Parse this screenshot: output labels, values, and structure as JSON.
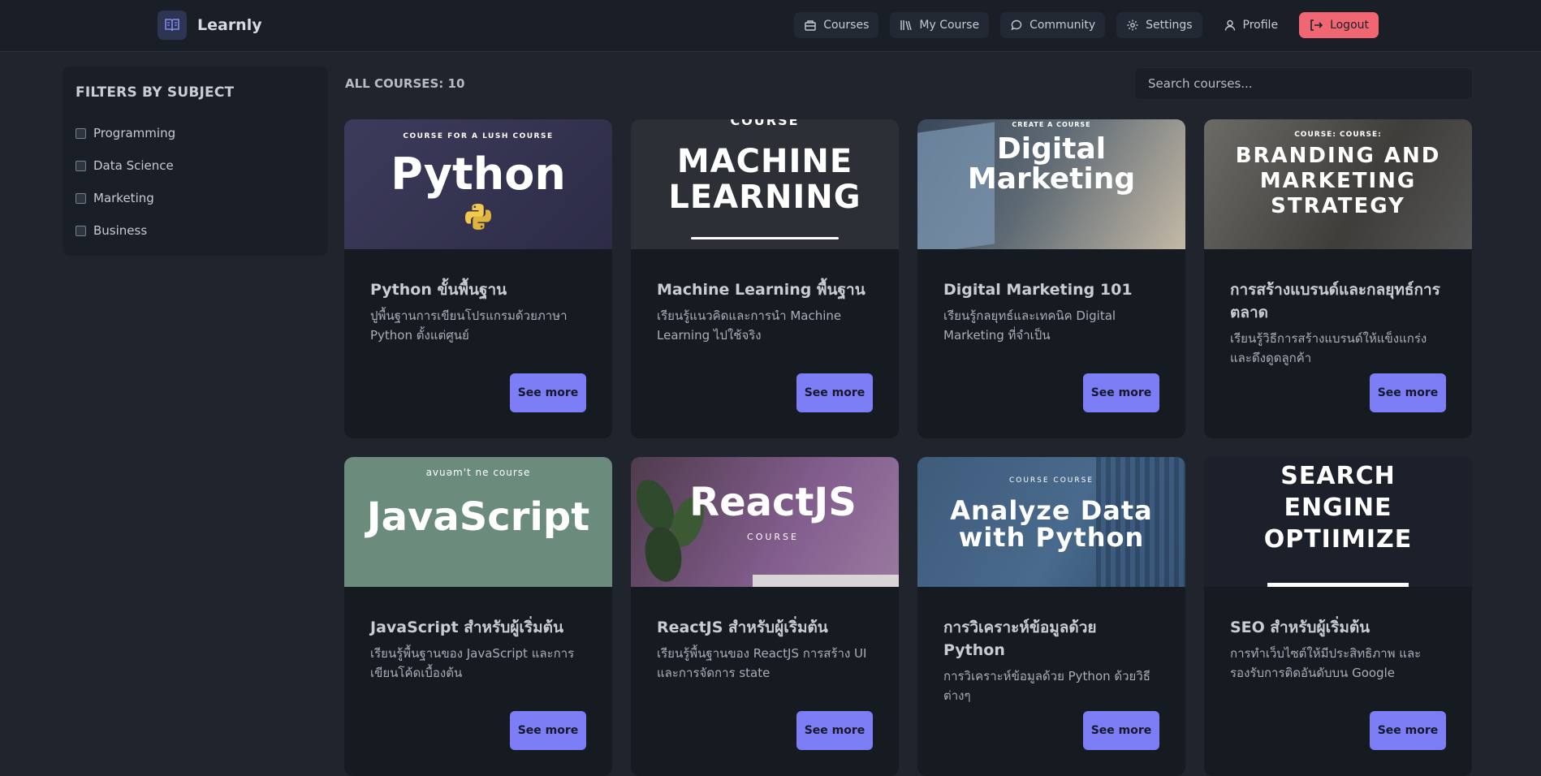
{
  "app": {
    "name": "Learnly",
    "logo_icon": "book-icon"
  },
  "nav": {
    "items": [
      {
        "label": "Courses",
        "icon": "courses-icon"
      },
      {
        "label": "My Course",
        "icon": "library-icon"
      },
      {
        "label": "Community",
        "icon": "chat-icon"
      },
      {
        "label": "Settings",
        "icon": "gear-icon"
      },
      {
        "label": "Profile",
        "icon": "user-icon"
      }
    ],
    "logout": {
      "label": "Logout",
      "icon": "logout-icon",
      "color": "#f06773"
    }
  },
  "sidebar": {
    "title": "FILTERS BY SUBJECT",
    "filters": [
      {
        "label": "Programming",
        "checked": false
      },
      {
        "label": "Data Science",
        "checked": false
      },
      {
        "label": "Marketing",
        "checked": false
      },
      {
        "label": "Business",
        "checked": false
      }
    ]
  },
  "main": {
    "count_label": "ALL COURSES: 10",
    "search_placeholder": "Search courses..."
  },
  "courses": [
    {
      "title": "Python ขั้นพื้นฐาน",
      "desc": "ปูพื้นฐานการเขียนโปรแกรมด้วยภาษา Python ตั้งแต่ศูนย์",
      "button": "See more",
      "image": {
        "kicker": "COURSE FOR A LUSH COURSE",
        "headline": "Python",
        "sub": ""
      }
    },
    {
      "title": "Machine Learning พื้นฐาน",
      "desc": "เรียนรู้แนวคิดและการนำ Machine Learning ไปใช้จริง",
      "button": "See more",
      "image": {
        "kicker": "COURSE",
        "headline": "MACHINE LEARNING",
        "sub": ""
      }
    },
    {
      "title": "Digital Marketing 101",
      "desc": "เรียนรู้กลยุทธ์และเทคนิค Digital Marketing ที่จำเป็น",
      "button": "See more",
      "image": {
        "kicker": "CREATE A COURSE",
        "headline": "Digital Marketing",
        "sub": ""
      }
    },
    {
      "title": "การสร้างแบรนด์และกลยุทธ์การตลาด",
      "desc": "เรียนรู้วิธีการสร้างแบรนด์ให้แข็งแกร่งและดึงดูดลูกค้า",
      "button": "See more",
      "image": {
        "kicker": "COURSE: COURSE:",
        "headline": "BRANDING AND MARKETING STRATEGY",
        "sub": ""
      }
    },
    {
      "title": "JavaScript สำหรับผู้เริ่มต้น",
      "desc": "เรียนรู้พื้นฐานของ JavaScript และการเขียนโค้ดเบื้องต้น",
      "button": "See more",
      "image": {
        "kicker": "avuəm't ne course",
        "headline": "JavaScript",
        "sub": ""
      }
    },
    {
      "title": "ReactJS สำหรับผู้เริ่มต้น",
      "desc": "เรียนรู้พื้นฐานของ ReactJS การสร้าง UI และการจัดการ state",
      "button": "See more",
      "image": {
        "kicker": "",
        "headline": "ReactJS",
        "sub": "COURSE"
      }
    },
    {
      "title": "การวิเคราะห์ข้อมูลด้วย Python",
      "desc": "การวิเคราะห์ข้อมูลด้วย Python ด้วยวิธีต่างๆ",
      "button": "See more",
      "image": {
        "kicker": "COURSE COURSE",
        "headline": "Analyze Data with Python",
        "sub": ""
      }
    },
    {
      "title": "SEO สำหรับผู้เริ่มต้น",
      "desc": "การทำเว็บไซต์ให้มีประสิทธิภาพ และรองรับการติดอันดับบน Google",
      "button": "See more",
      "image": {
        "kicker": "",
        "headline": "SEARCH ENGINE OPTIIMIZE",
        "sub": ""
      }
    }
  ]
}
